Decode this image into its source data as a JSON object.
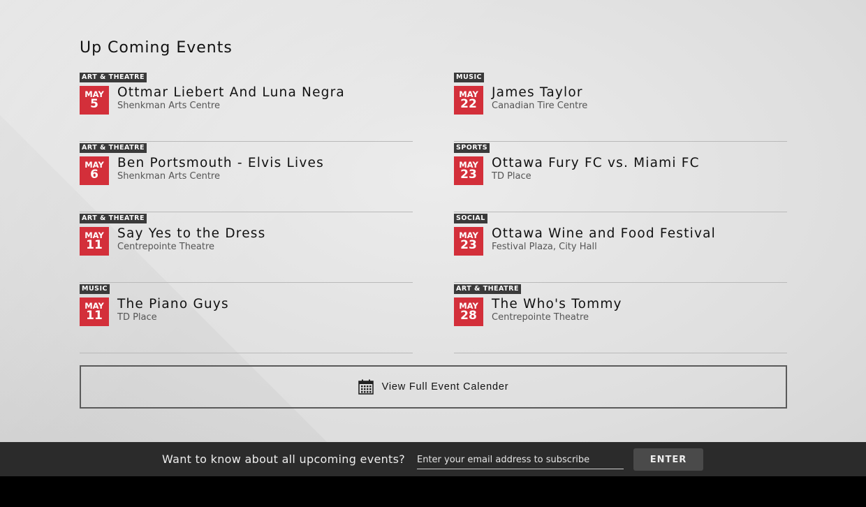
{
  "heading": "Up Coming Events",
  "events_left": [
    {
      "category": "ART & THEATRE",
      "month": "MAY",
      "day": "5",
      "title": "Ottmar Liebert And Luna Negra",
      "venue": "Shenkman Arts Centre"
    },
    {
      "category": "ART & THEATRE",
      "month": "MAY",
      "day": "6",
      "title": "Ben Portsmouth - Elvis Lives",
      "venue": "Shenkman Arts Centre"
    },
    {
      "category": "ART & THEATRE",
      "month": "MAY",
      "day": "11",
      "title": "Say Yes to the Dress",
      "venue": "Centrepointe Theatre"
    },
    {
      "category": "MUSIC",
      "month": "MAY",
      "day": "11",
      "title": "The Piano Guys",
      "venue": "TD Place"
    }
  ],
  "events_right": [
    {
      "category": "MUSIC",
      "month": "MAY",
      "day": "22",
      "title": "James Taylor",
      "venue": "Canadian Tire Centre"
    },
    {
      "category": "SPORTS",
      "month": "MAY",
      "day": "23",
      "title": "Ottawa Fury FC vs. Miami FC",
      "venue": "TD Place"
    },
    {
      "category": "SOCIAL",
      "month": "MAY",
      "day": "23",
      "title": "Ottawa Wine and Food Festival",
      "venue": "Festival Plaza, City Hall"
    },
    {
      "category": "ART & THEATRE",
      "month": "MAY",
      "day": "28",
      "title": "The Who's Tommy",
      "venue": "Centrepointe Theatre"
    }
  ],
  "calendar_button": {
    "label": "View Full Event Calender",
    "icon": "calendar-icon"
  },
  "subscribe": {
    "prompt": "Want to know about all upcoming events?",
    "placeholder": "Enter your email address to subscribe",
    "value": "",
    "button_label": "ENTER"
  },
  "colors": {
    "date_badge": "#d32f3a",
    "category_badge": "#3a3a3a",
    "footer_bg": "#2b2b2b"
  }
}
